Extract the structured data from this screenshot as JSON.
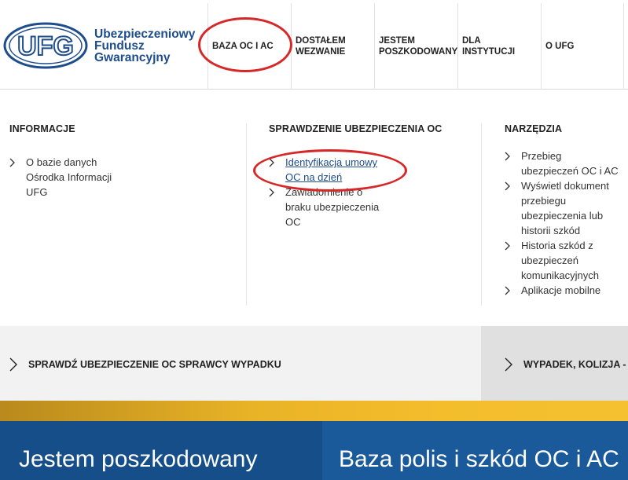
{
  "logo": {
    "mark": "UFG",
    "line1": "Ubezpieczeniowy",
    "line2": "Fundusz",
    "line3": "Gwarancyjny"
  },
  "nav": {
    "items": [
      {
        "label": "BAZA OC I AC"
      },
      {
        "line1": "DOSTAŁEM",
        "line2": "WEZWANIE"
      },
      {
        "line1": "JESTEM",
        "line2": "POSZKODOWANY"
      },
      {
        "line1": "DLA",
        "line2": "INSTYTUCJI"
      },
      {
        "label": "O UFG"
      }
    ]
  },
  "menu": {
    "col1": {
      "title": "INFORMACJE",
      "items": [
        {
          "lines": [
            "O bazie danych",
            "Ośrodka Informacji",
            "UFG"
          ]
        }
      ]
    },
    "col2": {
      "title": "SPRAWDZENIE UBEZPIECZENIA OC",
      "items": [
        {
          "lines": [
            "Identyfikacja umowy",
            "OC na dzień"
          ]
        },
        {
          "lines": [
            "Zawiadomienie o",
            "braku ubezpieczenia",
            "OC"
          ]
        }
      ]
    },
    "col3": {
      "title": "NARZĘDZIA",
      "items": [
        {
          "lines": [
            "Przebieg",
            "ubezpieczeń OC i AC"
          ]
        },
        {
          "lines": [
            "Wyświetl dokument",
            "przebiegu",
            "ubezpieczenia lub",
            "historii szkód"
          ]
        },
        {
          "lines": [
            "Historia szkód z",
            "ubezpieczeń",
            "komunikacyjnych"
          ]
        },
        {
          "lines": [
            "Aplikacje mobilne"
          ]
        }
      ]
    }
  },
  "bands": {
    "left_link": "SPRAWDŹ UBEZPIECZENIE OC SPRAWCY WYPADKU",
    "right_link": "WYPADEK, KOLIZJA -"
  },
  "hero": {
    "left_title": "Jestem poszkodowany",
    "right_title": "Baza polis i szkód OC i AC"
  },
  "colors": {
    "brand_blue": "#1e4d8c",
    "highlight_red": "#d62828",
    "gold": "#f3bd2c"
  }
}
